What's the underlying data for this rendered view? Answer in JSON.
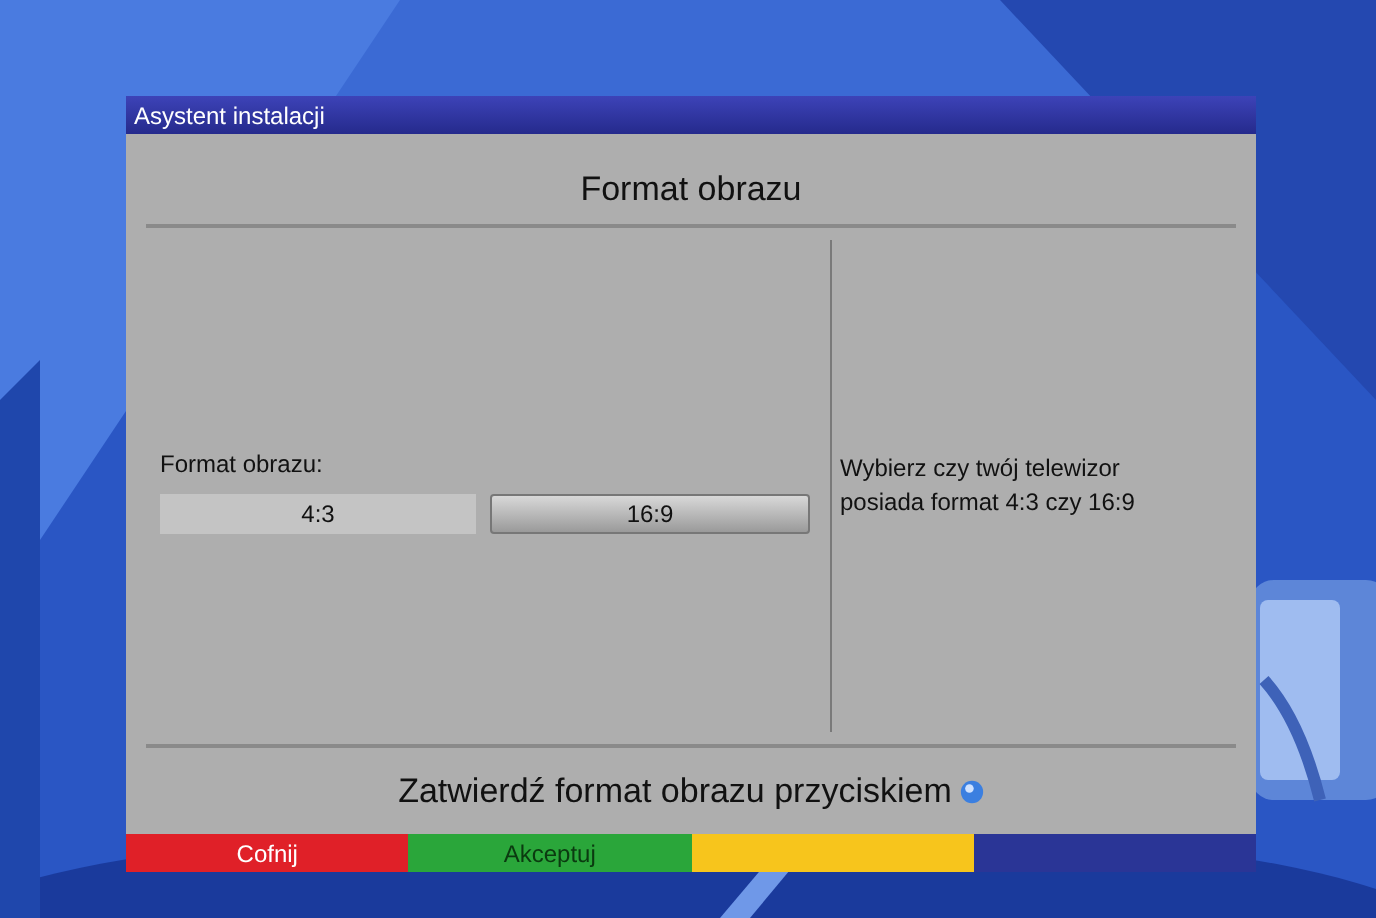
{
  "window": {
    "title": "Asystent instalacji"
  },
  "heading": "Format obrazu",
  "setting": {
    "label": "Format obrazu:",
    "options": [
      {
        "label": "4:3",
        "selected": false
      },
      {
        "label": "16:9",
        "selected": true
      }
    ]
  },
  "help": "Wybierz czy twój telewizor posiada format 4:3 czy 16:9",
  "hint": "Zatwierdź format obrazu przyciskiem",
  "color_keys": [
    {
      "label": "Cofnij",
      "color": "#e02028"
    },
    {
      "label": "Akceptuj",
      "color": "#2aa63a"
    },
    {
      "color": "#f7c51c"
    },
    {
      "color": "#2a3596"
    }
  ]
}
